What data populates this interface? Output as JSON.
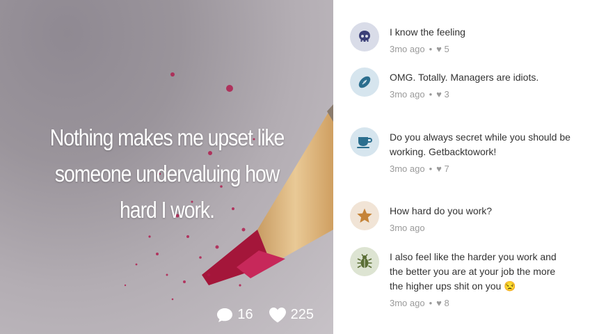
{
  "post": {
    "text": "Nothing makes me upset like someone undervaluing how hard I work.",
    "comment_count": "16",
    "like_count": "225"
  },
  "comments": [
    {
      "text": "I know the feeling",
      "time": "3mo ago",
      "likes": "♥ 5",
      "avatar_bg": "#d9dce8",
      "avatar_fg": "#3b3f78",
      "icon": "skull-icon"
    },
    {
      "text": "OMG. Totally. Managers are idiots.",
      "time": "3mo ago",
      "likes": "♥ 3",
      "avatar_bg": "#d6e5ee",
      "avatar_fg": "#2b6e8e",
      "icon": "football-icon"
    },
    {
      "text": "Do you always secret while you should be working. Getbacktowork!",
      "time": "3mo ago",
      "likes": "♥ 7",
      "avatar_bg": "#d6e5ee",
      "avatar_fg": "#2b6e8e",
      "icon": "coffee-cup-icon"
    },
    {
      "text": "How hard do you work?",
      "time": "3mo ago",
      "likes": "",
      "avatar_bg": "#f1e4d6",
      "avatar_fg": "#c58338",
      "icon": "star-icon"
    },
    {
      "text": "I also feel like the harder you work and the better you are at your job the more the higher ups shit on you 😒",
      "time": "3mo ago",
      "likes": "♥ 8",
      "avatar_bg": "#dde4d2",
      "avatar_fg": "#5a6e35",
      "icon": "bug-icon"
    }
  ]
}
